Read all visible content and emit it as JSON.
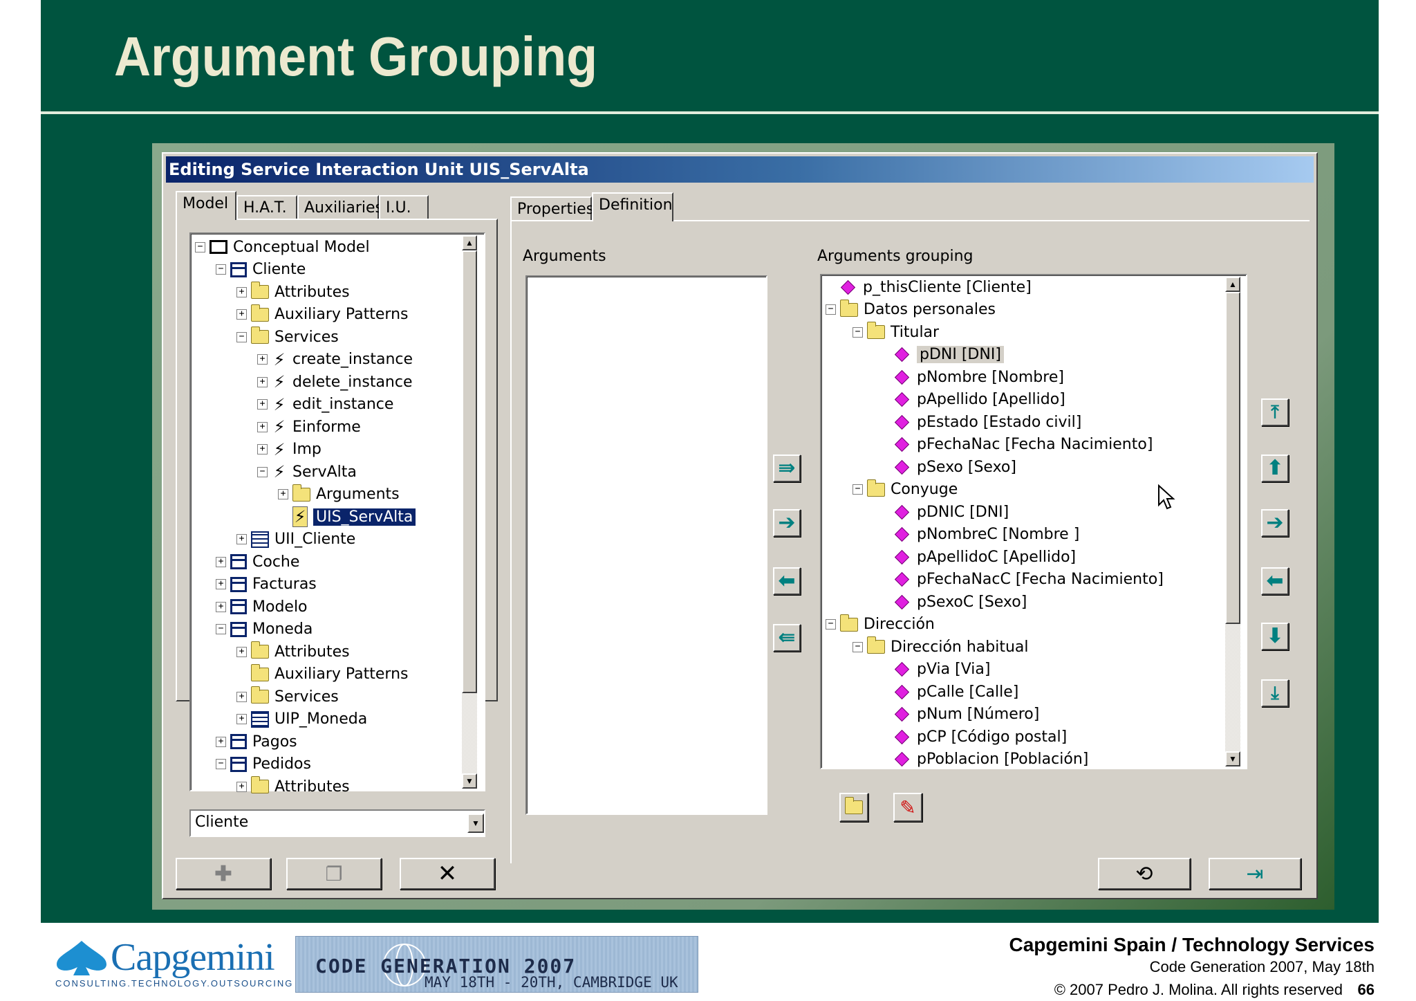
{
  "slide": {
    "title": "Argument Grouping",
    "footer": {
      "company": "Capgemini Spain / Technology Services",
      "event": "Code Generation 2007, May 18th",
      "copyright": "© 2007 Pedro J. Molina. All rights reserved",
      "page": "66",
      "logo_text": "Capgemini",
      "logo_tagline": "CONSULTING.TECHNOLOGY.OUTSOURCING",
      "banner_title": "CODE GENERATION 2007",
      "banner_subtitle": "MAY 18TH - 20TH, CAMBRIDGE UK"
    }
  },
  "window": {
    "title": "Editing Service Interaction Unit UIS_ServAlta",
    "left_tabs": [
      "Model",
      "H.A.T.",
      "Auxiliaries",
      "I.U."
    ],
    "right_tabs": [
      "Properties",
      "Definition"
    ],
    "model_tree": [
      {
        "label": "Conceptual Model",
        "exp": "−",
        "icon": "monitor"
      },
      {
        "label": "Cliente",
        "exp": "−",
        "icon": "class"
      },
      {
        "label": "Attributes",
        "exp": "+",
        "icon": "folder"
      },
      {
        "label": "Auxiliary Patterns",
        "exp": "+",
        "icon": "folder"
      },
      {
        "label": "Services",
        "exp": "−",
        "icon": "folder"
      },
      {
        "label": "create_instance",
        "exp": "+",
        "icon": "service"
      },
      {
        "label": "delete_instance",
        "exp": "+",
        "icon": "service"
      },
      {
        "label": "edit_instance",
        "exp": "+",
        "icon": "service"
      },
      {
        "label": "Einforme",
        "exp": "+",
        "icon": "service"
      },
      {
        "label": "Imp",
        "exp": "+",
        "icon": "service"
      },
      {
        "label": "ServAlta",
        "exp": "−",
        "icon": "service"
      },
      {
        "label": "Arguments",
        "exp": "+",
        "icon": "folder"
      },
      {
        "label": "UIS_ServAlta",
        "exp": "",
        "icon": "service-unit"
      },
      {
        "label": "UII_Cliente",
        "exp": "+",
        "icon": "instance-unit"
      },
      {
        "label": "Coche",
        "exp": "+",
        "icon": "class"
      },
      {
        "label": "Facturas",
        "exp": "+",
        "icon": "class"
      },
      {
        "label": "Modelo",
        "exp": "+",
        "icon": "class"
      },
      {
        "label": "Moneda",
        "exp": "−",
        "icon": "class"
      },
      {
        "label": "Attributes",
        "exp": "+",
        "icon": "folder"
      },
      {
        "label": "Auxiliary Patterns",
        "exp": "",
        "icon": "folder"
      },
      {
        "label": "Services",
        "exp": "+",
        "icon": "folder"
      },
      {
        "label": "UIP_Moneda",
        "exp": "+",
        "icon": "population-unit"
      },
      {
        "label": "Pagos",
        "exp": "+",
        "icon": "class"
      },
      {
        "label": "Pedidos",
        "exp": "−",
        "icon": "class"
      },
      {
        "label": "Attributes",
        "exp": "+",
        "icon": "folder"
      }
    ],
    "class_combo": "Cliente",
    "arguments_label": "Arguments",
    "grouping_label": "Arguments grouping",
    "grouping_tree": [
      {
        "label": "p_thisCliente [Cliente]",
        "exp": "",
        "icon": "argument"
      },
      {
        "label": "Datos personales",
        "exp": "−",
        "icon": "folder"
      },
      {
        "label": "Titular",
        "exp": "−",
        "icon": "folder"
      },
      {
        "label": "pDNI [DNI]",
        "exp": "",
        "icon": "argument"
      },
      {
        "label": "pNombre [Nombre]",
        "exp": "",
        "icon": "argument"
      },
      {
        "label": "pApellido [Apellido]",
        "exp": "",
        "icon": "argument"
      },
      {
        "label": "pEstado [Estado civil]",
        "exp": "",
        "icon": "argument"
      },
      {
        "label": "pFechaNac [Fecha Nacimiento]",
        "exp": "",
        "icon": "argument"
      },
      {
        "label": "pSexo [Sexo]",
        "exp": "",
        "icon": "argument"
      },
      {
        "label": "Conyuge",
        "exp": "−",
        "icon": "folder"
      },
      {
        "label": "pDNIC [DNI]",
        "exp": "",
        "icon": "argument"
      },
      {
        "label": "pNombreC [Nombre ]",
        "exp": "",
        "icon": "argument"
      },
      {
        "label": "pApellidoC [Apellido]",
        "exp": "",
        "icon": "argument"
      },
      {
        "label": "pFechaNacC [Fecha Nacimiento]",
        "exp": "",
        "icon": "argument"
      },
      {
        "label": "pSexoC [Sexo]",
        "exp": "",
        "icon": "argument"
      },
      {
        "label": "Dirección",
        "exp": "−",
        "icon": "folder"
      },
      {
        "label": "Dirección habitual",
        "exp": "−",
        "icon": "folder"
      },
      {
        "label": "pVia [Via]",
        "exp": "",
        "icon": "argument"
      },
      {
        "label": "pCalle [Calle]",
        "exp": "",
        "icon": "argument"
      },
      {
        "label": "pNum [Número]",
        "exp": "",
        "icon": "argument"
      },
      {
        "label": "pCP [Código postal]",
        "exp": "",
        "icon": "argument"
      },
      {
        "label": "pPoblacion [Población]",
        "exp": "",
        "icon": "argument"
      }
    ],
    "icons": {
      "move_all_right": "double-arrow-right-icon",
      "move_right": "arrow-right-icon",
      "move_left": "arrow-left-icon",
      "move_all_left": "double-arrow-left-icon",
      "move_top": "arrow-up-top-icon",
      "move_up": "arrow-up-icon",
      "indent": "arrow-right-icon",
      "outdent": "arrow-left-icon",
      "move_down": "arrow-down-icon",
      "move_bottom": "arrow-down-bottom-icon",
      "new_group": "new-folder-icon",
      "edit_group": "pencil-icon",
      "add": "plus-icon",
      "copy": "copy-icon",
      "delete": "close-icon",
      "undo": "undo-icon",
      "exit": "exit-icon"
    },
    "colors": {
      "slide_bg": "#00543f",
      "title": "#ece9cf",
      "titlebar_start": "#0a246a",
      "titlebar_end": "#a6caf0",
      "argument_icon": "#e020e0",
      "arrow_icon": "#008080"
    }
  }
}
